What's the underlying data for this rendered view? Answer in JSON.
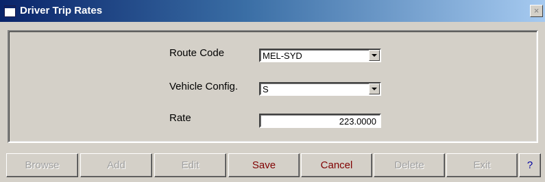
{
  "window": {
    "title": "Driver Trip Rates",
    "close_label": "×"
  },
  "form": {
    "route_code": {
      "label": "Route Code",
      "value": "MEL-SYD"
    },
    "vehicle_config": {
      "label": "Vehicle Config.",
      "value": "S"
    },
    "rate": {
      "label": "Rate",
      "value": "223.0000"
    }
  },
  "buttons": {
    "browse": "Browse",
    "add": "Add",
    "edit": "Edit",
    "save": "Save",
    "cancel": "Cancel",
    "delete": "Delete",
    "exit": "Exit",
    "help": "?"
  },
  "colors": {
    "title_bar_start": "#0a246a",
    "title_bar_end": "#a6caf0",
    "active_button_text": "#800000",
    "disabled_button_text": "#a0a0a0"
  }
}
